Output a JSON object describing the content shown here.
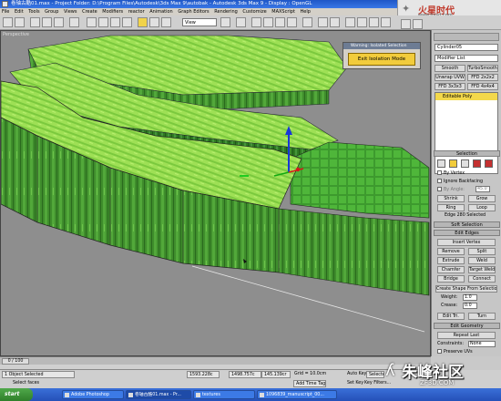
{
  "window": {
    "title": "卷轴古酷01.max - Project Folder: D:\\Program Files\\Autodesk\\3ds Max 9\\autobak - Autodesk 3ds Max 9 - Display : OpenGL"
  },
  "logo": {
    "mark": "✦",
    "text": "火星时代",
    "url": "www.hxsd.com"
  },
  "menu": [
    "File",
    "Edit",
    "Tools",
    "Group",
    "Views",
    "Create",
    "Modifiers",
    "reactor",
    "Animation",
    "Graph Editors",
    "Rendering",
    "Customize",
    "MAXScript",
    "Help"
  ],
  "toolbar": {
    "view_select": "View"
  },
  "viewport": {
    "label": "Perspective"
  },
  "isolation": {
    "title": "Warning: Isolated Selection",
    "button": "Exit Isolation Mode"
  },
  "command_panel": {
    "object_name": "Cylinder05",
    "modifier_list": "Modifier List",
    "buttons": [
      "Smooth",
      "TurboSmooth",
      "Unwrap UVW",
      "FFD 2x2x2",
      "FFD 3x3x3",
      "FFD 4x4x4"
    ],
    "stack_item": "Editable Poly",
    "selection": {
      "title": "Selection",
      "by_vertex": "By Vertex",
      "ignore_backfacing": "Ignore Backfacing",
      "by_angle": "By Angle:",
      "angle_value": "45.0",
      "shrink": "Shrink",
      "grow": "Grow",
      "ring": "Ring",
      "loop": "Loop",
      "status": "Edge 280 Selected"
    },
    "soft_selection": "Soft Selection",
    "edit_edges": {
      "title": "Edit Edges",
      "insert_vertex": "Insert Vertex",
      "remove": "Remove",
      "split": "Split",
      "extrude": "Extrude",
      "weld": "Weld",
      "chamfer": "Chamfer",
      "target_weld": "Target Weld",
      "bridge": "Bridge",
      "connect": "Connect",
      "create_shape": "Create Shape From Selection",
      "weight_label": "Weight:",
      "weight_value": "1.0",
      "crease_label": "Crease:",
      "crease_value": "0.0",
      "edit_tri": "Edit Tri.",
      "turn": "Turn"
    },
    "edit_geometry": {
      "title": "Edit Geometry",
      "repeat_last": "Repeat Last",
      "constraints_label": "Constraints:",
      "constraints_value": "None",
      "preserve_uvs": "Preserve UVs"
    }
  },
  "timeline": {
    "frame": "0 / 100"
  },
  "status": {
    "selected": "1 Object Selected",
    "prompt": "Select faces",
    "x": "1593.228c",
    "y": "1498.757c",
    "z": "145.139cr",
    "grid": "Grid = 10.0cm",
    "add_time_tag": "Add Time Tag",
    "auto_key": "Auto Key",
    "auto_key_value": "Selected",
    "set_key": "Set Key",
    "key_filters": "Key Filters..."
  },
  "taskbar": {
    "start": "start",
    "tasks": [
      "Adobe Photoshop",
      "卷轴古酷01.max - Pr...",
      "textures",
      "1096839_manuscript_00..."
    ]
  },
  "watermark": {
    "mark": "ʎ",
    "text": "朱峰社区",
    "url": "ZF3D.COM"
  },
  "colors": {
    "grass_light": "#8fe04a",
    "grass_dark": "#3c8a2a",
    "viewport_bg": "#8e8e8e",
    "highlight": "#f2cc3c"
  }
}
